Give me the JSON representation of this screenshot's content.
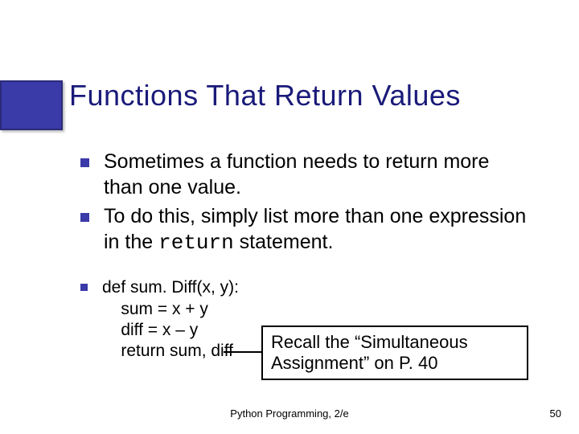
{
  "title": "Functions That Return Values",
  "bullets": [
    "Sometimes a function needs to return more than one value.",
    {
      "pre": "To do this, simply list more than one expression in the ",
      "code": "return",
      "post": " statement."
    }
  ],
  "code": "def sum. Diff(x, y):\n    sum = x + y\n    diff = x – y\n    return sum, diff",
  "callout": "Recall the “Simultaneous Assignment” on P. 40",
  "footer": {
    "center": "Python Programming, 2/e",
    "page": "50"
  }
}
